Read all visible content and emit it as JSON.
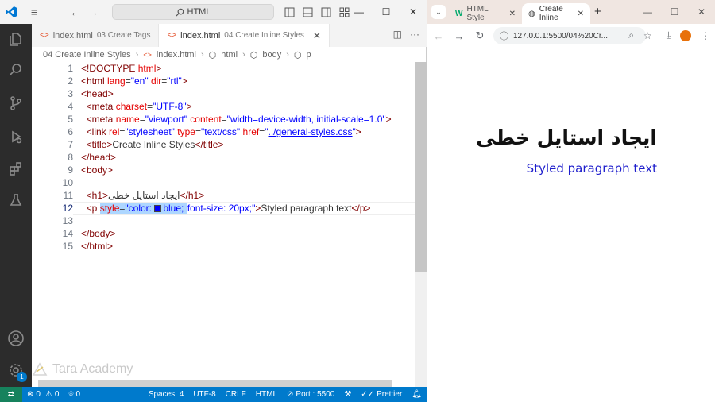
{
  "vscode": {
    "command_center": "HTML",
    "tabs": [
      {
        "name": "index.html",
        "desc": "03 Create Tags"
      },
      {
        "name": "index.html",
        "desc": "04 Create Inline Styles"
      }
    ],
    "breadcrumb": [
      "04 Create Inline Styles",
      "index.html",
      "html",
      "body",
      "p"
    ],
    "line_numbers": [
      "1",
      "2",
      "3",
      "4",
      "5",
      "6",
      "7",
      "8",
      "9",
      "10",
      "11",
      "12",
      "13",
      "14",
      "15"
    ],
    "code": {
      "l1": {
        "a": "<!DOCTYPE ",
        "b": "html",
        "c": ">"
      },
      "l2": {
        "t1": "<html ",
        "a1": "lang",
        "e1": "=",
        "v1": "\"en\"",
        "sp": " ",
        "a2": "dir",
        "e2": "=",
        "v2": "\"rtl\"",
        "t2": ">"
      },
      "l3": {
        "t": "<head>"
      },
      "l4": {
        "t1": "<meta ",
        "a1": "charset",
        "e1": "=",
        "v1": "\"UTF-8\"",
        "t2": ">"
      },
      "l5": {
        "t1": "<meta ",
        "a1": "name",
        "e1": "=",
        "v1": "\"viewport\"",
        "a2": " content",
        "e2": "=",
        "v2": "\"width=device-width, initial-scale=1.0\"",
        "t2": ">"
      },
      "l6": {
        "t1": "<link ",
        "a1": "rel",
        "e1": "=",
        "v1": "\"stylesheet\"",
        "a2": " type",
        "e2": "=",
        "v2": "\"text/css\"",
        "a3": " href",
        "e3": "=",
        "q1": "\"",
        "u": "../general-styles.css",
        "q2": "\"",
        "t2": ">"
      },
      "l7": {
        "t1": "<title>",
        "txt": "Create Inline Styles",
        "t2": "</title>"
      },
      "l8": {
        "t": "</head>"
      },
      "l9": {
        "t": "<body>"
      },
      "l11": {
        "t1": "<h1>",
        "txt": "ایجاد استایل خطی",
        "t2": "</h1>"
      },
      "l12": {
        "t1": "<p ",
        "a1": "style",
        "e1": "=",
        "v1": "\"color: ",
        "v2": "blue; ",
        "v3": "font-size: 20px;\"",
        "t2": ">",
        "txt": "Styled paragraph text",
        "t3": "</p>"
      },
      "l14": {
        "t": "</body>"
      },
      "l15": {
        "t": "</html>"
      }
    },
    "watermark": "Tara Academy",
    "status": {
      "errors": "0",
      "warnings": "0",
      "ports": "0",
      "spaces": "Spaces: 4",
      "encoding": "UTF-8",
      "eol": "CRLF",
      "language": "HTML",
      "port": "Port : 5500",
      "prettier": "Prettier"
    },
    "notification_badge": "1",
    "colors": {
      "accent": "#007acc",
      "activity_bar": "#2c2c2c",
      "remote": "#16825d"
    }
  },
  "chrome": {
    "tabs": [
      {
        "title": "HTML Style"
      },
      {
        "title": "Create Inline"
      }
    ],
    "url": "127.0.0.1:5500/04%20Cr...",
    "page": {
      "h1": "ایجاد استایل خطی",
      "p": "Styled paragraph text"
    },
    "colors": {
      "tabstrip": "#f0e6e1",
      "paragraph": "#1e1ecc"
    }
  }
}
